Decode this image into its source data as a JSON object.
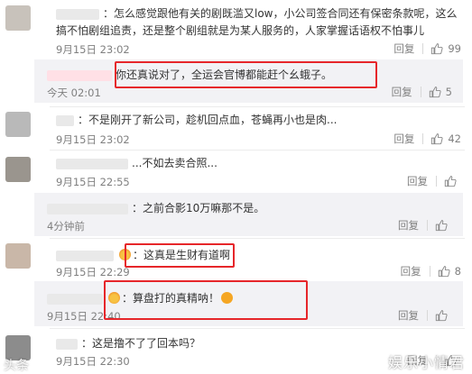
{
  "comments": [
    {
      "text": "：怎么感觉跟他有关的剧既滥又low，小公司签合同还有保密条款呢，这么搞不怕剧组追责，还是整个剧组就是为某人服务的，人家掌握话语权不怕事儿",
      "time": "9月15日 23:02",
      "reply": "回复",
      "likes": "99"
    },
    {
      "text": "你还真说对了，全运会官博都能赶个幺蛾子。",
      "time": "今天 02:01",
      "reply": "回复",
      "likes": "5"
    },
    {
      "text": "：不是刚开了新公司，趁机回点血，苍蝇再小也是肉...",
      "time": "9月15日 23:02",
      "reply": "回复",
      "likes": "42"
    },
    {
      "text": "...不如去卖合照...",
      "time": "9月15日 22:55",
      "reply": "回复",
      "likes": ""
    },
    {
      "text": "：之前合影10万嘛那不是。",
      "time": "4分钟前",
      "reply": "回复",
      "likes": ""
    },
    {
      "text": "：这真是生财有道啊",
      "time": "9月15日 22:29",
      "reply": "回复",
      "likes": "8"
    },
    {
      "text": "：算盘打的真精呐！",
      "time": "9月15日 22:40",
      "reply": "回复",
      "likes": ""
    },
    {
      "text": "：这是撸不了了回本吗？",
      "time": "9月15日 22:30",
      "reply": "回复",
      "likes": ""
    }
  ],
  "watermark": "娱乐小情君",
  "watermark_left": "头条",
  "colors": {
    "highlight_box": "#e6262a",
    "sub_bg": "#f2f2f5"
  },
  "icons": {
    "like": "thumbs-up-icon",
    "emoji_laugh": "laugh-emoji-icon",
    "emoji_fire": "fire-emoji-icon"
  }
}
